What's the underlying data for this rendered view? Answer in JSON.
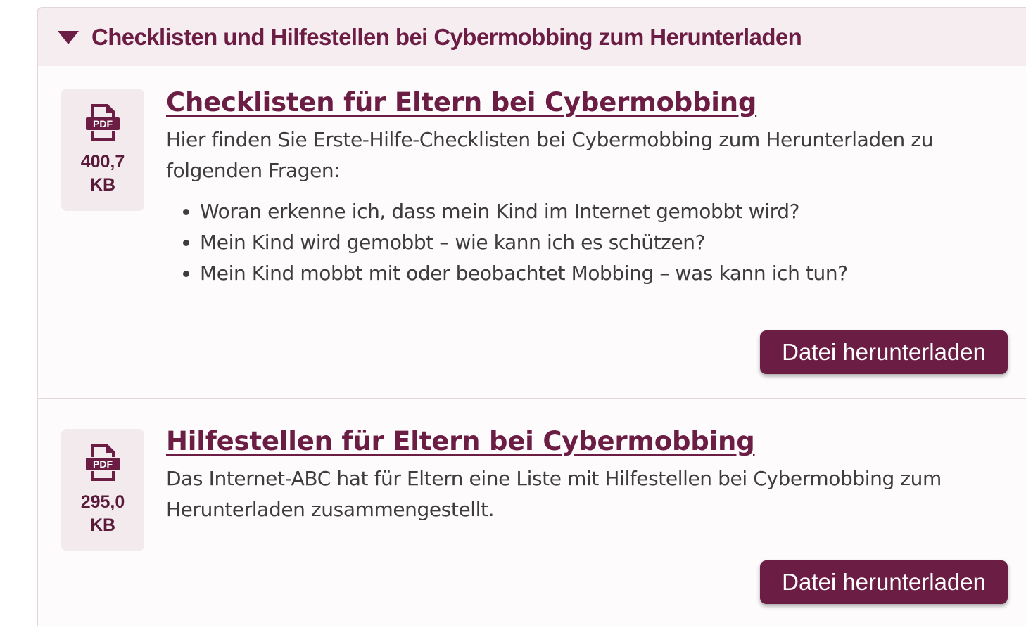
{
  "colors": {
    "accent": "#6b1d44",
    "header_bg": "#f6edf1",
    "file_box_bg": "#f3eaee",
    "border": "#e4d6dd",
    "body_text": "#3d3d3d"
  },
  "section": {
    "title": "Checklisten und Hilfestellen bei Cybermobbing zum Herunterladen",
    "toggle_icon": "triangle-down-icon"
  },
  "items": [
    {
      "icon": "pdf-icon",
      "file_size_value": "400,7",
      "file_size_unit": "KB",
      "title": "Checklisten für Eltern bei Cybermobbing",
      "description": "Hier finden Sie Erste-Hilfe-Checklisten bei Cybermobbing zum Herunterladen zu folgenden Fragen:",
      "bullets": [
        "Woran erkenne ich, dass mein Kind im Internet gemobbt wird?",
        "Mein Kind wird gemobbt – wie kann ich es schützen?",
        "Mein Kind mobbt mit oder beobachtet Mobbing – was kann ich tun?"
      ],
      "button_label": "Datei herunterladen"
    },
    {
      "icon": "pdf-icon",
      "file_size_value": "295,0",
      "file_size_unit": "KB",
      "title": "Hilfestellen für Eltern bei Cybermobbing",
      "description": "Das Internet-ABC hat für Eltern eine Liste mit Hilfestellen bei Cybermobbing zum Herunterladen zusammengestellt.",
      "button_label": "Datei herunterladen"
    }
  ]
}
